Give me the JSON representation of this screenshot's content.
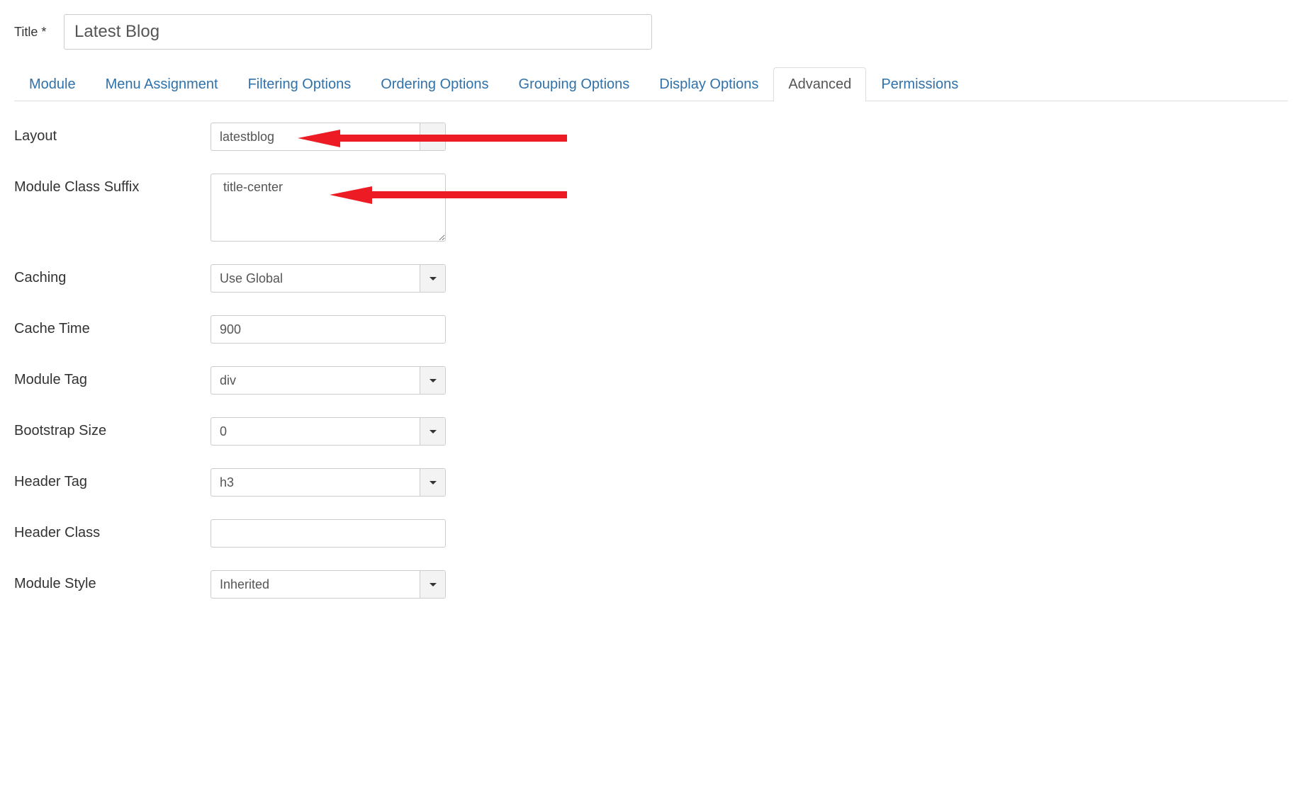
{
  "title": {
    "label": "Title *",
    "value": "Latest Blog"
  },
  "tabs": [
    {
      "label": "Module"
    },
    {
      "label": "Menu Assignment"
    },
    {
      "label": "Filtering Options"
    },
    {
      "label": "Ordering Options"
    },
    {
      "label": "Grouping Options"
    },
    {
      "label": "Display Options"
    },
    {
      "label": "Advanced"
    },
    {
      "label": "Permissions"
    }
  ],
  "active_tab": "Advanced",
  "fields": {
    "layout": {
      "label": "Layout",
      "value": "latestblog"
    },
    "module_class_suffix": {
      "label": "Module Class Suffix",
      "value": " title-center"
    },
    "caching": {
      "label": "Caching",
      "value": "Use Global"
    },
    "cache_time": {
      "label": "Cache Time",
      "value": "900"
    },
    "module_tag": {
      "label": "Module Tag",
      "value": "div"
    },
    "bootstrap_size": {
      "label": "Bootstrap Size",
      "value": "0"
    },
    "header_tag": {
      "label": "Header Tag",
      "value": "h3"
    },
    "header_class": {
      "label": "Header Class",
      "value": ""
    },
    "module_style": {
      "label": "Module Style",
      "value": "Inherited"
    }
  },
  "annotation_color": "#ed1c24"
}
